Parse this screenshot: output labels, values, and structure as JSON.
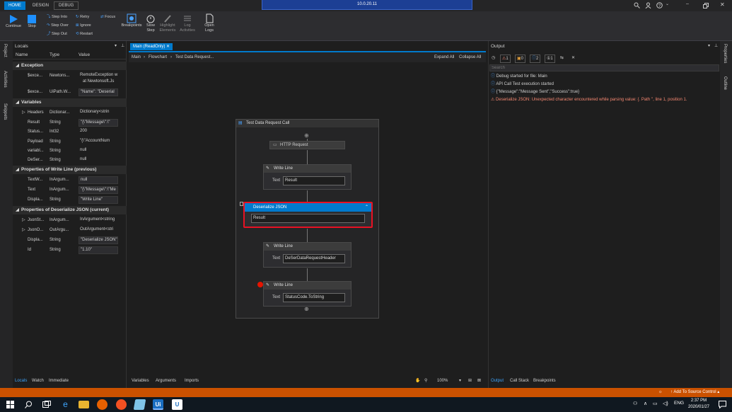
{
  "title_tabs": {
    "home": "HOME",
    "design": "DESIGN",
    "debug": "DEBUG"
  },
  "remote": {
    "title": "10.0.20.11"
  },
  "ribbon": {
    "continue": "Continue",
    "stop": "Stop",
    "step_into": "Step Into",
    "step_over": "Step Over",
    "step_out": "Step Out",
    "retry": "Retry",
    "ignore": "Ignore",
    "restart": "Restart",
    "focus": "Focus",
    "breakpoints": "Breakpoints",
    "slow_step": "Slow Step",
    "highlight": "Highlight Elements",
    "log": "Log Activities",
    "open_logs": "Open Logs"
  },
  "left_strip": {
    "project": "Project",
    "activities": "Activities",
    "snippets": "Snippets"
  },
  "locals": {
    "title": "Locals",
    "col_name": "Name",
    "col_type": "Type",
    "col_value": "Value",
    "groups": {
      "exception": "Exception",
      "variables": "Variables",
      "wl_prev": "Properties of Write Line (previous)",
      "dj_curr": "Properties of Deserialize JSON (current)"
    },
    "exception_rows": [
      {
        "name": "$exce...",
        "type": "Newtons...",
        "value": "RemoteException w"
      },
      {
        "name": "$exce...",
        "type": "UiPath.W...",
        "value": "\"Name\": \"Deserial"
      }
    ],
    "exception_sub": "at Newtonsoft.Js",
    "variable_rows": [
      {
        "name": "Headers",
        "type": "Dictionar...",
        "value": "Dictionary<strin"
      },
      {
        "name": "Result",
        "type": "String",
        "value": "\"{\\\"Message\\\":\\\""
      },
      {
        "name": "Status...",
        "type": "Int32",
        "value": "200"
      },
      {
        "name": "Payload",
        "type": "String",
        "value": "\"{\\\"AccountNum"
      },
      {
        "name": "variabl...",
        "type": "String",
        "value": "null"
      },
      {
        "name": "DeSer...",
        "type": "String",
        "value": "null"
      }
    ],
    "wl_rows": [
      {
        "name": "TextW...",
        "type": "InArgum...",
        "value": "null"
      },
      {
        "name": "Text",
        "type": "InArgum...",
        "value": "\"{\\\"Message\\\":\\\"Me"
      },
      {
        "name": "Displa...",
        "type": "String",
        "value": "\"Write Line\""
      }
    ],
    "dj_rows": [
      {
        "name": "JsonSt...",
        "type": "InArgum...",
        "value": "InArgument<string"
      },
      {
        "name": "JsonO...",
        "type": "OutArgu...",
        "value": "OutArgument<stri"
      },
      {
        "name": "Displa...",
        "type": "String",
        "value": "\"Deserialize JSON\""
      },
      {
        "name": "Id",
        "type": "String",
        "value": "\"1.10\""
      }
    ],
    "tabs": {
      "locals": "Locals",
      "watch": "Watch",
      "immediate": "Immediate"
    }
  },
  "designer": {
    "tab": "Main (ReadOnly)",
    "breadcrumb": {
      "a": "Main",
      "b": "Flowchart",
      "c": "Test Data Request..."
    },
    "expand_all": "Expand All",
    "collapse_all": "Collapse All",
    "sequence_title": "Test Data Request Call",
    "http": "HTTP Request",
    "wl1_title": "Write Line",
    "wl1_label": "Text",
    "wl1_value": "Result",
    "dj_title": "Deserialize JSON",
    "dj_value": "Result",
    "wl2_title": "Write Line",
    "wl2_label": "Text",
    "wl2_value": "DeSerDataRequestHeader",
    "wl3_title": "Write Line",
    "wl3_label": "Text",
    "wl3_value": "StatusCode.ToString",
    "bottom": {
      "variables": "Variables",
      "arguments": "Arguments",
      "imports": "Imports",
      "zoom": "100%"
    }
  },
  "output": {
    "title": "Output",
    "count_err": "1",
    "count_warn": "0",
    "count_info": "2",
    "count_trace": "1",
    "search_placeholder": "Search",
    "lines": [
      {
        "text": "Debug started for file: Main"
      },
      {
        "text": "API Call Test execution started"
      },
      {
        "text": "{\"Message\":\"Message Sent\",\"Success\":true}"
      },
      {
        "text": "Deserialize JSON: Unexpected character encountered while parsing value: {. Path '', line 1, position 1."
      }
    ],
    "tabs": {
      "output": "Output",
      "callstack": "Call Stack",
      "breakpoints": "Breakpoints"
    }
  },
  "right_strip": {
    "properties": "Properties",
    "outline": "Outline"
  },
  "statusbar": {
    "source_control": "Add To Source Control"
  },
  "taskbar": {
    "time": "2:37 PM",
    "date": "2020/01/27",
    "lang": "ENG"
  },
  "colors": {
    "accent": "#007acc",
    "error": "#f48771",
    "status": "#ca5100",
    "highlight": "#e81123"
  }
}
